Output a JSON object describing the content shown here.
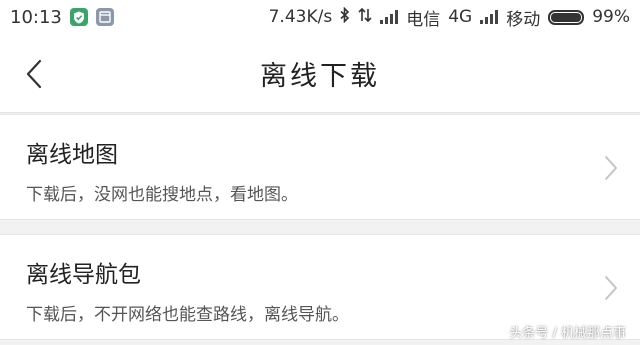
{
  "status_bar": {
    "time": "10:13",
    "network_speed": "7.43K/s",
    "carrier1": "电信",
    "network_type": "4G",
    "carrier2": "移动",
    "battery": "99%",
    "battery_level": 0.99,
    "icons": [
      "shield-icon",
      "app-icon",
      "bluetooth-icon",
      "data-transfer-icon",
      "signal-icon",
      "signal-icon",
      "battery-icon"
    ]
  },
  "header": {
    "title": "离线下载",
    "back_icon": "chevron-left-icon"
  },
  "list": {
    "items": [
      {
        "title": "离线地图",
        "description": "下载后，没网也能搜地点，看地图。"
      },
      {
        "title": "离线导航包",
        "description": "下载后，不开网络也能查路线，离线导航。"
      }
    ]
  },
  "watermark": "头条号 / 机械那点事",
  "colors": {
    "background": "#f2f2f2",
    "surface": "#ffffff",
    "text_primary": "#222222",
    "text_secondary": "#555555",
    "chevron": "#c4c4c4",
    "shield_badge": "#3aa56b"
  }
}
